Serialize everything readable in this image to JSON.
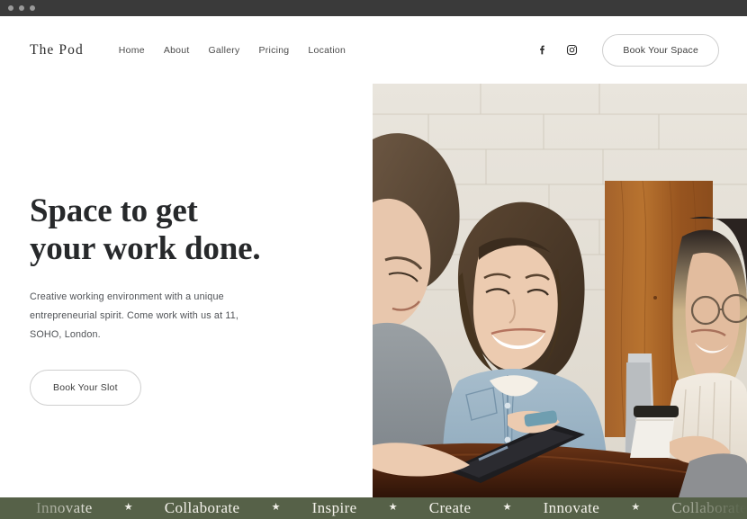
{
  "window": {
    "dots": [
      "close-dot",
      "minimize-dot",
      "maximize-dot"
    ]
  },
  "header": {
    "logo": "The Pod",
    "nav": [
      {
        "label": "Home"
      },
      {
        "label": "About"
      },
      {
        "label": "Gallery"
      },
      {
        "label": "Pricing"
      },
      {
        "label": "Location"
      }
    ],
    "social": [
      {
        "name": "facebook-icon",
        "label": "Facebook"
      },
      {
        "name": "instagram-icon",
        "label": "Instagram"
      }
    ],
    "cta": "Book Your Space"
  },
  "hero": {
    "headline_line1": "Space to get",
    "headline_line2": "your work done.",
    "paragraph": "Creative working environment with a unique entrepreneurial spirit. Come work with us at 11, SOHO, London.",
    "cta": "Book Your Slot",
    "image_alt": "Three colleagues smiling around a wooden table with a tablet, laptop and coffee cup in front of a white brick wall"
  },
  "marquee": {
    "separator": "★",
    "words": [
      "Innovate",
      "Collaborate",
      "Inspire",
      "Create",
      "Innovate",
      "Collaborate"
    ]
  },
  "colors": {
    "marquee_bg": "#566148",
    "marquee_text": "#f3f1ea",
    "chrome_bg": "#3a3a3a",
    "heading": "#27292b",
    "body_text": "#4f5256",
    "border": "#cfcfcf"
  }
}
